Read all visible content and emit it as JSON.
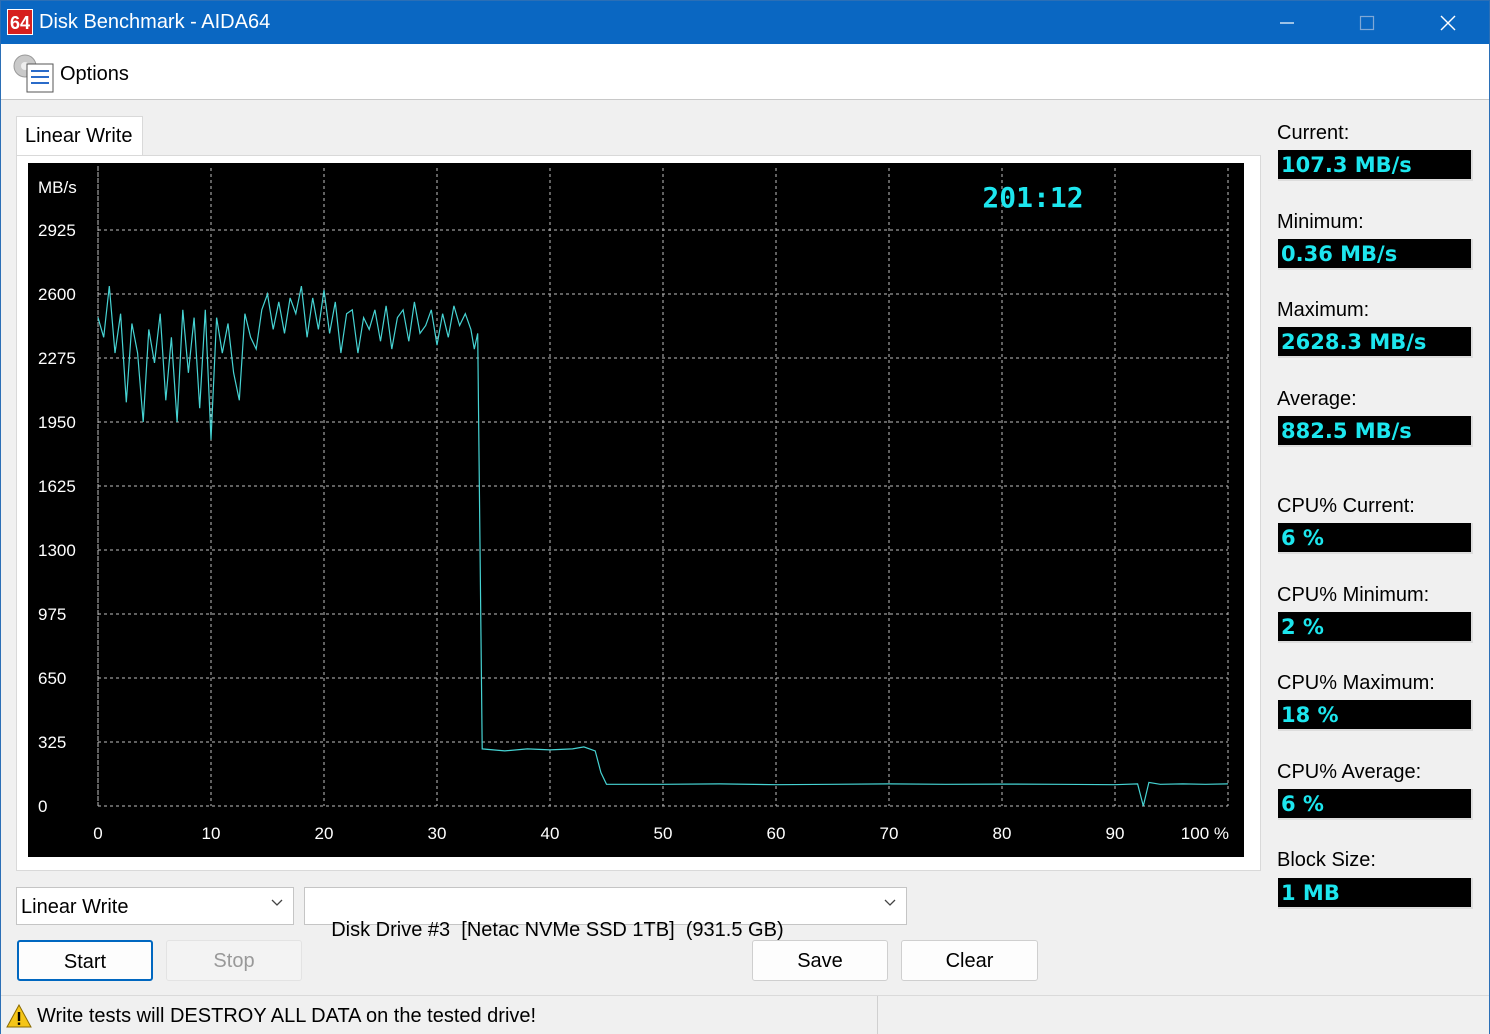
{
  "window": {
    "title": "Disk Benchmark - AIDA64",
    "icon_text": "64",
    "minimize_icon": "minimize-icon",
    "maximize_icon": "maximize-icon",
    "close_icon": "close-icon"
  },
  "menu": {
    "options_label": "Options",
    "options_icon": "options-icon"
  },
  "tab": {
    "label": "Linear Write"
  },
  "chart_data": {
    "type": "line",
    "timer": "201:12",
    "ylabel": "MB/s",
    "xlabel": "",
    "y_ticks": [
      "2925",
      "2600",
      "2275",
      "1950",
      "1625",
      "1300",
      "975",
      "650",
      "325",
      "0"
    ],
    "x_ticks": [
      "0",
      "10",
      "20",
      "30",
      "40",
      "50",
      "60",
      "70",
      "80",
      "90",
      "100 %"
    ],
    "ylim": [
      0,
      3250
    ],
    "xlim": [
      0,
      100
    ],
    "grid": true,
    "series_color": "#46d3d3",
    "series": [
      {
        "name": "",
        "x": [
          0,
          0.5,
          1,
          1.5,
          2,
          2.5,
          3,
          3.5,
          4,
          4.5,
          5,
          5.5,
          6,
          6.5,
          7,
          7.5,
          8,
          8.5,
          9,
          9.5,
          10,
          10.5,
          11,
          11.5,
          12,
          12.5,
          13,
          13.5,
          14,
          14.5,
          15,
          15.5,
          16,
          16.5,
          17,
          17.5,
          18,
          18.5,
          19,
          19.5,
          20,
          20.5,
          21,
          21.5,
          22,
          22.5,
          23,
          23.5,
          24,
          24.5,
          25,
          25.5,
          26,
          26.5,
          27,
          27.5,
          28,
          28.5,
          29,
          29.5,
          30,
          30.5,
          31,
          31.5,
          32,
          32.5,
          33,
          33.3,
          33.6,
          34,
          36,
          38,
          40,
          42,
          43,
          44,
          44.5,
          45,
          46,
          50,
          55,
          60,
          65,
          70,
          75,
          80,
          85,
          90,
          92,
          92.5,
          93,
          94,
          96,
          98,
          100
        ],
        "y": [
          2480,
          2380,
          2640,
          2300,
          2500,
          2050,
          2450,
          2300,
          1950,
          2420,
          2250,
          2500,
          2060,
          2380,
          1950,
          2520,
          2200,
          2480,
          2020,
          2520,
          1860,
          2480,
          2300,
          2450,
          2200,
          2060,
          2500,
          2380,
          2320,
          2520,
          2600,
          2420,
          2560,
          2400,
          2580,
          2500,
          2640,
          2380,
          2580,
          2420,
          2620,
          2400,
          2560,
          2300,
          2500,
          2520,
          2300,
          2480,
          2420,
          2520,
          2360,
          2540,
          2320,
          2480,
          2520,
          2360,
          2560,
          2400,
          2440,
          2520,
          2340,
          2500,
          2380,
          2540,
          2440,
          2500,
          2420,
          2320,
          2400,
          290,
          280,
          290,
          285,
          290,
          300,
          280,
          170,
          110,
          110,
          110,
          112,
          108,
          110,
          112,
          110,
          111,
          110,
          108,
          112,
          0,
          120,
          110,
          112,
          110,
          112
        ]
      }
    ]
  },
  "stats": [
    {
      "label": "Current:",
      "value": "107.3 MB/s"
    },
    {
      "label": "Minimum:",
      "value": "0.36 MB/s"
    },
    {
      "label": "Maximum:",
      "value": "2628.3 MB/s"
    },
    {
      "label": "Average:",
      "value": "882.5 MB/s"
    },
    {
      "label": "CPU% Current:",
      "value": "6 %"
    },
    {
      "label": "CPU% Minimum:",
      "value": "2 %"
    },
    {
      "label": "CPU% Maximum:",
      "value": "18 %"
    },
    {
      "label": "CPU% Average:",
      "value": "6 %"
    },
    {
      "label": "Block Size:",
      "value": "1 MB"
    }
  ],
  "controls": {
    "test_select": "Linear Write",
    "drive_select": "Disk Drive #3  [Netac NVMe SSD 1TB]  (931.5 GB)",
    "start_label": "Start",
    "stop_label": "Stop",
    "save_label": "Save",
    "clear_label": "Clear"
  },
  "status": {
    "warning_icon": "warning-icon",
    "text": "Write tests will DESTROY ALL DATA on the tested drive!"
  }
}
